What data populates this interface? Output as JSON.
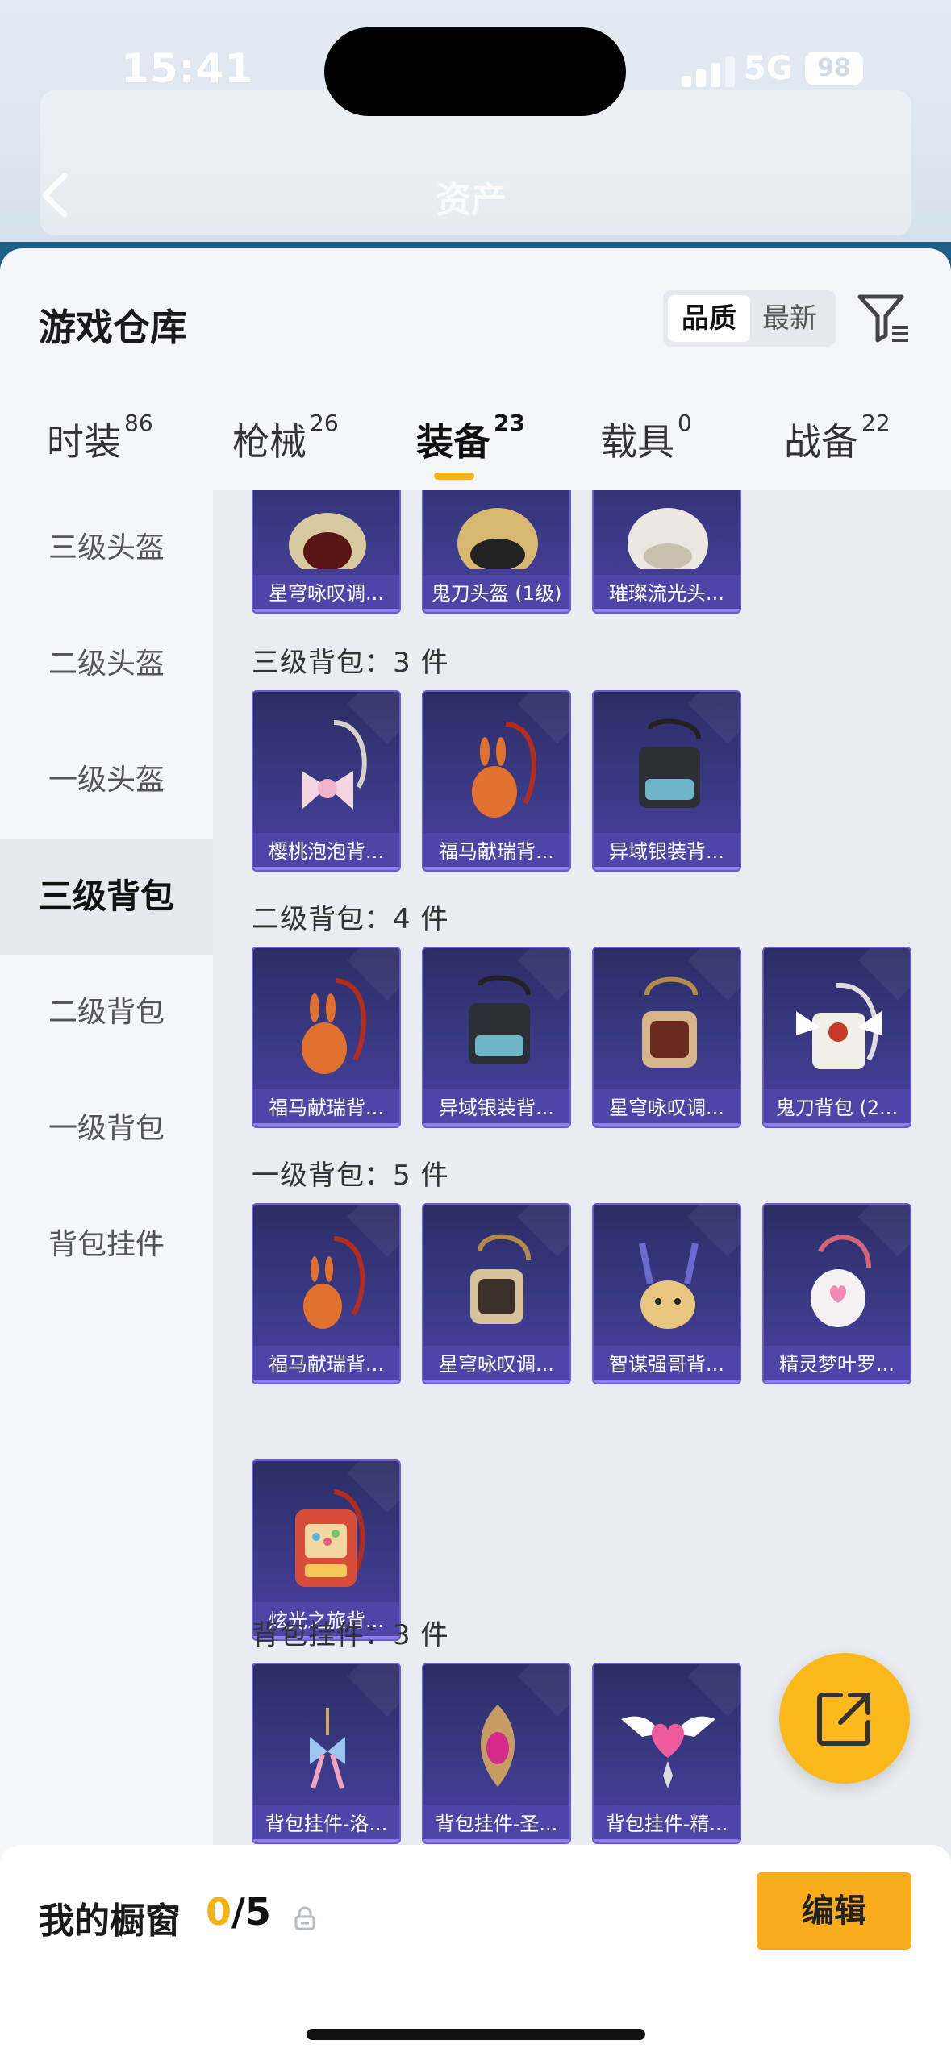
{
  "status": {
    "time": "15:41",
    "network": "5G",
    "battery": "98"
  },
  "header": {
    "title": "资产"
  },
  "sheet": {
    "title": "游戏仓库",
    "sort": {
      "active": "品质",
      "inactive": "最新"
    }
  },
  "tabs": [
    {
      "label": "时装",
      "count": "86"
    },
    {
      "label": "枪械",
      "count": "26"
    },
    {
      "label": "装备",
      "count": "23"
    },
    {
      "label": "载具",
      "count": "0"
    },
    {
      "label": "战备",
      "count": "22"
    }
  ],
  "sidebar": [
    {
      "label": "三级头盔"
    },
    {
      "label": "二级头盔"
    },
    {
      "label": "一级头盔"
    },
    {
      "label": "三级背包"
    },
    {
      "label": "二级背包"
    },
    {
      "label": "一级背包"
    },
    {
      "label": "背包挂件"
    }
  ],
  "groups": {
    "helmet3": {
      "items": [
        "星穹咏叹调...",
        "鬼刀头盔 (1级)",
        "璀璨流光头..."
      ]
    },
    "bag3": {
      "title": "三级背包：3 件",
      "items": [
        "樱桃泡泡背...",
        "福马献瑞背...",
        "异域银装背..."
      ]
    },
    "bag2": {
      "title": "二级背包：4 件",
      "items": [
        "福马献瑞背...",
        "异域银装背...",
        "星穹咏叹调...",
        "鬼刀背包 (2..."
      ]
    },
    "bag1": {
      "title": "一级背包：5 件",
      "items": [
        "福马献瑞背...",
        "星穹咏叹调...",
        "智谋强哥背...",
        "精灵梦叶罗...",
        "炫光之旅背..."
      ]
    },
    "pendant": {
      "title": "背包挂件：3 件",
      "items": [
        "背包挂件-洛...",
        "背包挂件-圣...",
        "背包挂件-精..."
      ]
    }
  },
  "bottom": {
    "title": "我的橱窗",
    "current": "0",
    "total": "/5",
    "edit_label": "编辑"
  },
  "colors": {
    "accent": "#f9ad1c",
    "card_bg": "#3a3a86"
  },
  "icons": [
    "back-icon",
    "filter-icon",
    "lock-icon",
    "share-icon"
  ]
}
